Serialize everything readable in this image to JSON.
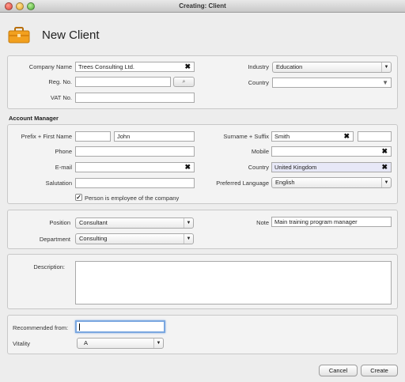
{
  "window": {
    "title": "Creating: Client"
  },
  "header": {
    "title": "New Client",
    "icon": "briefcase-icon",
    "icon_color": "#f2a01e"
  },
  "company": {
    "company_name_label": "Company Name",
    "company_name_value": "Trees Consulting Ltd.",
    "reg_no_label": "Reg. No.",
    "reg_no_value": "",
    "vat_no_label": "VAT No.",
    "vat_no_value": "",
    "industry_label": "Industry",
    "industry_value": "Education",
    "country_label": "Country",
    "country_value": ""
  },
  "account_manager": {
    "section_title": "Account Manager",
    "prefix_label": "Prefix + First Name",
    "prefix_value": "",
    "first_name_value": "John",
    "surname_label": "Surname + Suffix",
    "surname_value": "Smith",
    "suffix_value": "",
    "phone_label": "Phone",
    "phone_value": "",
    "mobile_label": "Mobile",
    "mobile_value": "",
    "email_label": "E-mail",
    "email_value": "",
    "country_label": "Country",
    "country_value": "United Kingdom",
    "salutation_label": "Salutation",
    "salutation_value": "",
    "language_label": "Preferred Language",
    "language_value": "English",
    "employee_checkbox_label": "Person is employee of the company",
    "employee_checked": true
  },
  "position": {
    "position_label": "Position",
    "position_value": "Consultant",
    "note_label": "Note",
    "note_value": "Main training program manager",
    "department_label": "Department",
    "department_value": "Consulting"
  },
  "description": {
    "label": "Description:",
    "value": ""
  },
  "extra": {
    "recommended_label": "Recommended from:",
    "recommended_value": "",
    "vitality_label": "Vitality",
    "vitality_value": "A"
  },
  "footer": {
    "cancel_label": "Cancel",
    "create_label": "Create"
  },
  "colors": {
    "highlight_field": "#e7e8f7",
    "focus_ring": "#7aa7e0"
  }
}
